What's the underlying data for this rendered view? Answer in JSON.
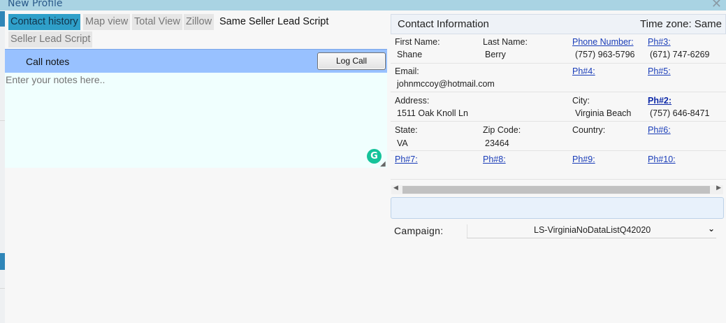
{
  "window": {
    "title": "New Profile",
    "close_icon": "close-icon"
  },
  "tabs": [
    {
      "label": "Contact history",
      "active": true
    },
    {
      "label": "Map view"
    },
    {
      "label": "Total View"
    },
    {
      "label": "Zillow"
    },
    {
      "label": "Same Seller Lead Script"
    },
    {
      "label": "Seller Lead Script"
    }
  ],
  "call_notes": {
    "label": "Call notes",
    "log_call_label": "Log Call",
    "placeholder": "Enter your notes here.."
  },
  "contact_info": {
    "header": "Contact Information",
    "timezone": "Time zone: Same",
    "first_name_label": "First Name:",
    "first_name": "Shane",
    "last_name_label": "Last Name:",
    "last_name": "Berry",
    "phone_label": "Phone Number:",
    "phone": "(757) 963-5796",
    "ph3_label": "Ph#3:",
    "ph3": "(671) 747-6269",
    "email_label": "Email:",
    "email": "johnmccoy@hotmail.com",
    "ph4_label": "Ph#4:",
    "ph5_label": "Ph#5:",
    "address_label": "Address:",
    "address": "1511 Oak Knoll Ln",
    "city_label": "City:",
    "city": "Virginia Beach",
    "ph2_label": "Ph#2:",
    "ph2": "(757) 646-8471",
    "state_label": "State:",
    "state": "VA",
    "zip_label": "Zip Code:",
    "zip": "23464",
    "country_label": "Country:",
    "ph6_label": "Ph#6:",
    "ph7_label": "Ph#7:",
    "ph8_label": "Ph#8:",
    "ph9_label": "Ph#9:",
    "ph10_label": "Ph#10:"
  },
  "campaign": {
    "label": "Campaign:",
    "value": "LS-VirginiaNoDataListQ42020"
  }
}
